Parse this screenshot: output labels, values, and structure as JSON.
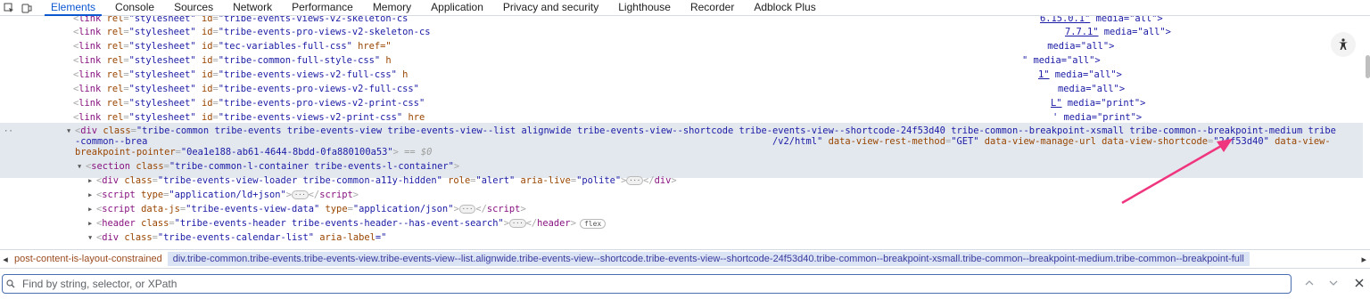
{
  "tabs": [
    "Elements",
    "Console",
    "Sources",
    "Network",
    "Performance",
    "Memory",
    "Application",
    "Privacy and security",
    "Lighthouse",
    "Recorder",
    "Adblock Plus"
  ],
  "active_tab": "Elements",
  "lines": {
    "l0": {
      "tag": "link",
      "rel_attr": "rel",
      "rel_val": "\"stylesheet\"",
      "id_attr": "id",
      "id_val": "\"tribe-events-views-v2-skeleton-cs",
      "tail": "6.15.0.1\"",
      "media": " media=\"all\">"
    },
    "l1": {
      "tag": "link",
      "rel_attr": "rel",
      "rel_val": "\"stylesheet\"",
      "id_attr": "id",
      "id_val": "\"tribe-events-pro-views-v2-skeleton-cs",
      "tail": "7.7.1\"",
      "media": " media=\"all\">"
    },
    "l2": {
      "tag": "link",
      "rel_attr": "rel",
      "rel_val": "\"stylesheet\"",
      "id_attr": "id",
      "id_val": "\"tec-variables-full-css\"",
      "href": " href=\"",
      "media": " media=\"all\">"
    },
    "l3": {
      "tag": "link",
      "rel_attr": "rel",
      "rel_val": "\"stylesheet\"",
      "id_attr": "id",
      "id_val": "\"tribe-common-full-style-css\"",
      "h": " h",
      "media": "\" media=\"all\">"
    },
    "l4": {
      "tag": "link",
      "rel_attr": "rel",
      "rel_val": "\"stylesheet\"",
      "id_attr": "id",
      "id_val": "\"tribe-events-views-v2-full-css\"",
      "h": " h",
      "tail": "1\"",
      "media": " media=\"all\">"
    },
    "l5": {
      "tag": "link",
      "rel_attr": "rel",
      "rel_val": "\"stylesheet\"",
      "id_attr": "id",
      "id_val": "\"tribe-events-pro-views-v2-full-css\"",
      "media": "media=\"all\">"
    },
    "l6": {
      "tag": "link",
      "rel_attr": "rel",
      "rel_val": "\"stylesheet\"",
      "id_attr": "id",
      "id_val": "\"tribe-events-pro-views-v2-print-css\"",
      "tail": "L\"",
      "media": " media=\"print\">"
    },
    "l7": {
      "tag": "link",
      "rel_attr": "rel",
      "rel_val": "\"stylesheet\"",
      "id_attr": "id",
      "id_val": "\"tribe-events-views-v2-print-css\"",
      "href": " hre",
      "media": "' media=\"print\">"
    },
    "div_open": {
      "part1": "\"tribe-common tribe-events tribe-events-view tribe-events-view--list alignwide tribe-events-view--shortcode tribe-events-view--shortcode-24f53d40 tribe-common--breakpoint-xsmall tribe-common--breakpoint-medium tribe",
      "part2": "-common--brea",
      "part3_val": "/v2/html\"",
      "m_attr": "data-view-rest-method",
      "m_val": "\"GET\"",
      "mu_attr": "data-view-manage-url",
      "sc_attr": "data-view-shortcode",
      "sc_val": "\"24f53d40\"",
      "dv_attr": "data-view-",
      "bp_attr": "breakpoint-pointer",
      "bp_val": "\"0ea1e188-ab61-4644-8bdd-0fa880100a53\"",
      "selected_marker": "== $0"
    },
    "section": {
      "class_val": "\"tribe-common-l-container tribe-events-l-container\""
    },
    "loader": {
      "class_val": "\"tribe-events-view-loader tribe-common-a11y-hidden\"",
      "role_val": "\"alert\"",
      "live_val": "\"polite\""
    },
    "script1": {
      "type_val": "\"application/ld+json\""
    },
    "script2": {
      "js_val": "\"tribe-events-view-data\"",
      "type_val": "\"application/json\""
    },
    "header": {
      "class_val": "\"tribe-events-header tribe-events-header--has-event-search\"",
      "badge": "flex"
    },
    "calendar": {
      "class_val": "\"tribe-events-calendar-list\"",
      "label_attr": "aria-label",
      "label_val": "=\""
    }
  },
  "breadcrumb": {
    "first": "post-content-is-layout-constrained",
    "second": "div.tribe-common.tribe-events.tribe-events-view.tribe-events-view--list.alignwide.tribe-events-view--shortcode.tribe-events-view--shortcode-24f53d40.tribe-common--breakpoint-xsmall.tribe-common--breakpoint-medium.tribe-common--breakpoint-full"
  },
  "search": {
    "placeholder": "Find by string, selector, or XPath",
    "value": ""
  },
  "colors": {
    "accent": "#0b57d0",
    "arrow": "#f0357f",
    "selection": "#e3e8ee"
  },
  "icons": [
    "inspect-element-icon",
    "device-toolbar-icon",
    "accessibility-icon",
    "search-icon",
    "chevron-up-icon",
    "chevron-down-icon",
    "close-icon"
  ]
}
